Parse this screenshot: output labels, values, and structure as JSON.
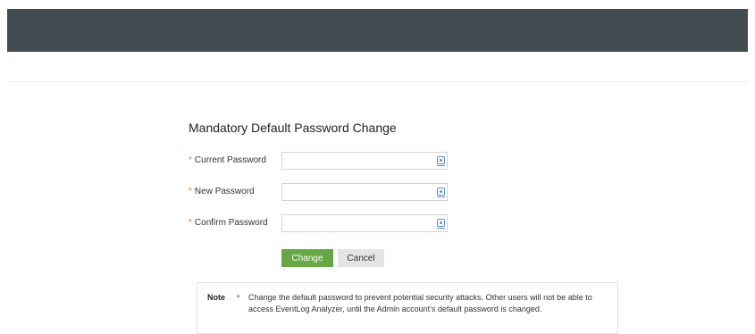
{
  "form": {
    "title": "Mandatory Default Password Change",
    "required_mark": "*",
    "fields": [
      {
        "label": "Current Password",
        "value": "",
        "placeholder": ""
      },
      {
        "label": "New Password",
        "value": "",
        "placeholder": ""
      },
      {
        "label": "Confirm Password",
        "value": "",
        "placeholder": ""
      }
    ],
    "change_label": "Change",
    "cancel_label": "Cancel"
  },
  "note": {
    "label": "Note",
    "bullet": "•",
    "text": "Change the default password to prevent potential security attacks. Other users will not be able to access EventLog Analyzer, until the Admin account's default password is changed."
  },
  "colors": {
    "header_bar": "#434c51",
    "accent_green": "#66a845",
    "required_star": "#e87f2f",
    "icon_blue": "#5b8fc9"
  },
  "icons": {
    "show_password": "eye-icon"
  }
}
